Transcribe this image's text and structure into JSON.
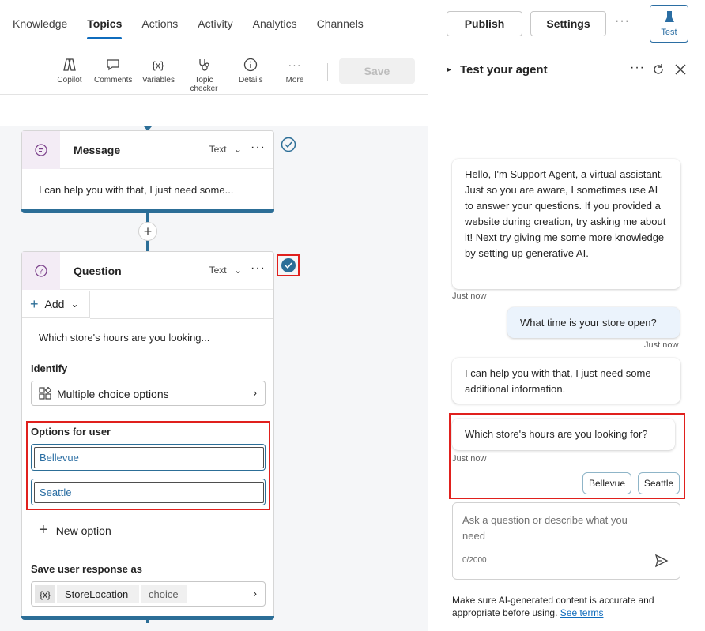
{
  "nav": {
    "tabs": [
      "Knowledge",
      "Topics",
      "Actions",
      "Activity",
      "Analytics",
      "Channels"
    ],
    "publish_label": "Publish",
    "settings_label": "Settings",
    "more_label": "···",
    "test_label": "Test"
  },
  "toolbar": {
    "items": [
      "Copilot",
      "Comments",
      "Variables",
      "Topic checker",
      "Details",
      "More"
    ],
    "save_label": "Save"
  },
  "message_node": {
    "title": "Message",
    "type": "Text",
    "text": "I can help you with that, I just need some..."
  },
  "question_node": {
    "title": "Question",
    "type": "Text",
    "add_label": "Add",
    "prompt": "Which store's hours are you looking...",
    "identify_label": "Identify",
    "identify_value": "Multiple choice options",
    "options_label": "Options for user",
    "options": [
      "Bellevue",
      "Seattle"
    ],
    "new_option_label": "New option",
    "save_as_label": "Save user response as",
    "var_icon": "{x}",
    "var_name": "StoreLocation",
    "var_type": "choice"
  },
  "panel": {
    "title": "Test your agent",
    "greeting": "Hello, I'm Support Agent, a virtual assistant. Just so you are aware, I sometimes use AI to answer your questions. If you provided a website during creation, try asking me about it! Next try giving me some more knowledge by setting up generative AI.",
    "greeting_time": "Just now",
    "user_message": "What time is your store open?",
    "user_time": "Just now",
    "bot_reply": "I can help you with that, I just need some additional information.",
    "bot_question": "Which store's hours are you looking for?",
    "question_time": "Just now",
    "choices": [
      "Bellevue",
      "Seattle"
    ],
    "input_placeholder": "Ask a question or describe what you need",
    "char_count": "0/2000",
    "disclaimer": "Make sure AI-generated content is accurate and appropriate before using.",
    "see_terms": "See terms"
  }
}
